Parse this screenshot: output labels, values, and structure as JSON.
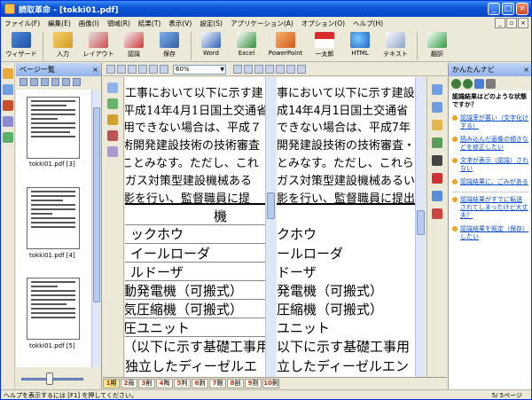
{
  "window": {
    "title": "読取革命 - [tokki01.pdf]"
  },
  "menu": [
    "ファイル(F)",
    "編集(E)",
    "画像(I)",
    "領域(R)",
    "結果(T)",
    "表示(V)",
    "設定(S)",
    "アプリケーション(A)",
    "オプション(O)",
    "ヘルプ(H)"
  ],
  "toolbar": [
    "ウィザード",
    "入力",
    "レイアウト",
    "認識",
    "保存",
    "Word",
    "Excel",
    "PowerPoint",
    "一太郎",
    "HTML",
    "テキスト",
    "翻訳"
  ],
  "left_panel": {
    "title": "ページ一覧",
    "thumbnails": [
      "tokki01.pdf [3]",
      "tokki01.pdf [4]",
      "tokki01.pdf [5]"
    ]
  },
  "zoom": "60%",
  "doc_left": {
    "lines": [
      "工事において以下に示す建",
      "平成14年4月1日国土交通省",
      "用できない場合は、平成７",
      "術開発建設技術の技術審査",
      "ことみなす。ただし、これ",
      "ガス対策型建設機械ある",
      "影を行い、監督職員に提"
    ],
    "header": "機",
    "lines2": [
      "ックホウ",
      "イールローダ",
      "ルドーザ",
      "動発電機（可搬式）",
      "気圧縮機（可搬式）",
      "圧ユニット",
      "（以下に示す基礎工事用",
      "独立したディーゼルエ"
    ]
  },
  "doc_right": {
    "lines": [
      "事において以下に示す建設",
      "成14年4月1日国土交通省",
      "できない場合は、平成7年",
      "開発建設技術の技術審査・",
      "とみなす。ただし、これら",
      "ガス対策型建設機械あるい",
      "影を行い、監督職員に提出"
    ],
    "lines2": [
      "クホウ",
      "ールローダ",
      "ドーザ",
      "発電機（可搬式）",
      "圧縮機（可搬式）",
      "ユニット",
      "以下に示す基礎工事用",
      "立したディーゼルエン"
    ]
  },
  "page_tabs": [
    "期",
    "局",
    "削",
    "陶",
    "判",
    "剥",
    "剛",
    "剖",
    "割",
    "剣"
  ],
  "right_panel": {
    "title": "かんたんナビ",
    "question": "認識結果はどのような状態ですか？",
    "items": [
      "認識率が悪い（文字化けする）",
      "読み込んだ画像の傾きなどを修正したい",
      "文字が表示（認識）されない",
      "認識結果に、ごみがある",
      "認識結果がすでに転送されてしまったけど大丈夫？",
      "認識結果を既定（保存）したい"
    ]
  },
  "status": {
    "left": "ヘルプを表示するには [F1] を押してください。",
    "right": "5/ 5ページ"
  }
}
